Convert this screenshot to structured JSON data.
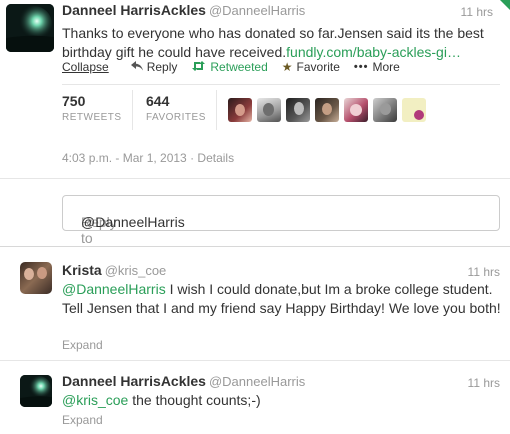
{
  "main_tweet": {
    "name": "Danneel HarrisAckles",
    "handle": "@DanneelHarris",
    "time": "11 hrs",
    "text_plain": "Thanks to everyone who has donated so far.Jensen said its the best birthday gift he could have received.",
    "text_link": "fundly.com/baby-ackles-gi…",
    "actions": {
      "collapse": "Collapse",
      "reply": "Reply",
      "retweeted": "Retweeted",
      "favorite": "Favorite",
      "more": "More"
    },
    "stats": {
      "retweets_count": "750",
      "retweets_label": "RETWEETS",
      "favorites_count": "644",
      "favorites_label": "FAVORITES"
    },
    "timestamp": "4:03 p.m. - Mar 1, 2013",
    "details": "Details"
  },
  "reply_box": {
    "prefix": "Reply to ",
    "mention": "@DanneelHarris"
  },
  "replies": [
    {
      "name": "Krista",
      "handle": "@kris_coe",
      "time": "11 hrs",
      "mention": "@DanneelHarris",
      "text": " I wish I could donate,but Im a broke college student. Tell Jensen that I and my friend say Happy Birthday! We love you both!",
      "expand": "Expand"
    },
    {
      "name": "Danneel HarrisAckles",
      "handle": "@DanneelHarris",
      "time": "11 hrs",
      "mention": "@kris_coe",
      "text": " the thought counts;-)",
      "expand": "Expand"
    }
  ],
  "colors": {
    "accent_green": "#2a9e58",
    "muted_gray": "#999999"
  }
}
